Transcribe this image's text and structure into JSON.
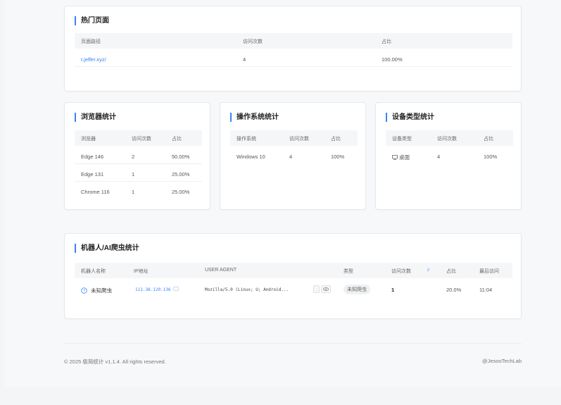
{
  "hot_pages": {
    "title": "热门页面",
    "headers": [
      "页面路径",
      "访问次数",
      "占比"
    ],
    "rows": [
      {
        "path": "t.jeffer.xyz/",
        "visits": "4",
        "ratio": "100.00%"
      }
    ]
  },
  "browser_stats": {
    "title": "浏览器统计",
    "headers": [
      "浏览器",
      "访问次数",
      "占比"
    ],
    "rows": [
      {
        "name": "Edge 146",
        "visits": "2",
        "ratio": "50.00%"
      },
      {
        "name": "Edge 131",
        "visits": "1",
        "ratio": "25.00%"
      },
      {
        "name": "Chrome 116",
        "visits": "1",
        "ratio": "25.00%"
      }
    ]
  },
  "os_stats": {
    "title": "操作系统统计",
    "headers": [
      "操作系统",
      "访问次数",
      "占比"
    ],
    "rows": [
      {
        "name": "Windows 10",
        "visits": "4",
        "ratio": "100%"
      }
    ]
  },
  "device_stats": {
    "title": "设备类型统计",
    "headers": [
      "设备类型",
      "访问次数",
      "占比"
    ],
    "rows": [
      {
        "icon": "desktop-icon",
        "name": "桌面",
        "visits": "4",
        "ratio": "100%"
      }
    ]
  },
  "bot_stats": {
    "title": "机器人/AI爬虫统计",
    "headers": {
      "name": "机器人名称",
      "ip": "IP地址",
      "ua": "USER AGENT",
      "type": "类型",
      "visits": "访问次数",
      "sort_glyph": "↓↑",
      "ratio": "占比",
      "last": "最后访问"
    },
    "rows": [
      {
        "icon": "question-circle-icon",
        "name": "未知爬虫",
        "ip": "111.38.120.136",
        "ua": "Mozilla/5.0 (Linux; U; Android...",
        "type": "未知爬虫",
        "visits": "1",
        "ratio": "20.0%",
        "last": "11:04"
      }
    ]
  },
  "footer": {
    "copyright": "© 2025 极简统计 v1.1.4. All rights reserved.",
    "brand": "@JesooTechLab"
  },
  "colors": {
    "accent": "#3b82f6",
    "background": "#f7f8fa",
    "card": "#ffffff"
  }
}
